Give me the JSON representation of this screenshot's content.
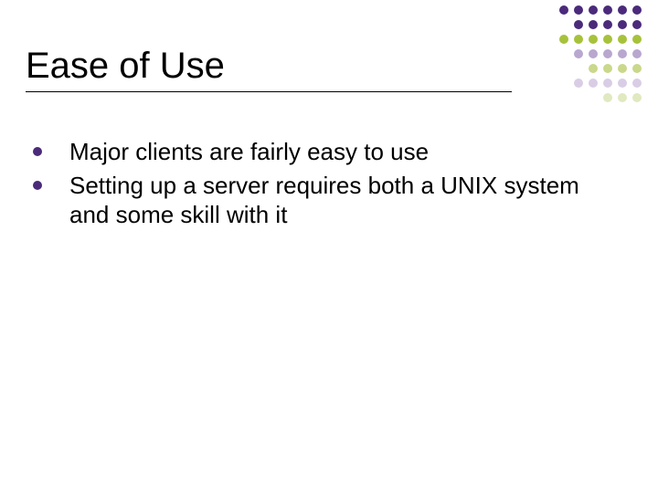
{
  "title": "Ease of Use",
  "bullets": [
    "Major clients are fairly easy to use",
    "Setting up a server requires both a UNIX system and some skill with it"
  ],
  "deco": {
    "rows": [
      [
        "#4b2a7b",
        "#4b2a7b",
        "#4b2a7b",
        "#4b2a7b",
        "#4b2a7b",
        "#4b2a7b"
      ],
      [
        "#4b2a7b",
        "#4b2a7b",
        "#4b2a7b",
        "#4b2a7b",
        "#4b2a7b"
      ],
      [
        "#a7c23a",
        "#a7c23a",
        "#a7c23a",
        "#a7c23a",
        "#a7c23a",
        "#a7c23a"
      ],
      [
        "#b9a7cf",
        "#b9a7cf",
        "#b9a7cf",
        "#b9a7cf",
        "#b9a7cf"
      ],
      [
        "#c9d88a",
        "#c9d88a",
        "#c9d88a",
        "#c9d88a"
      ],
      [
        "#d9cde6",
        "#d9cde6",
        "#d9cde6",
        "#d9cde6",
        "#d9cde6"
      ],
      [
        "#e0e9c0",
        "#e0e9c0",
        "#e0e9c0"
      ]
    ]
  }
}
